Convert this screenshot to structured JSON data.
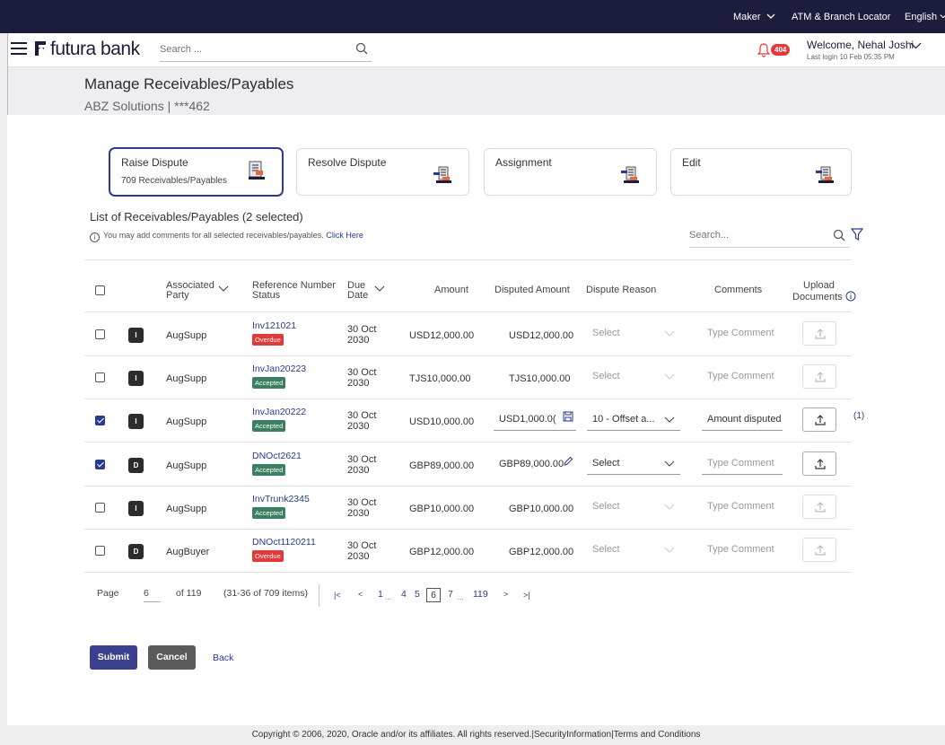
{
  "topbar": {
    "role": "Maker",
    "atm_locator": "ATM & Branch Locator",
    "language": "English"
  },
  "header": {
    "brand": "futura bank",
    "search_placeholder": "Search ...",
    "notification_count": "404",
    "welcome": "Welcome, Nehal Joshi",
    "last_login": "Last login 10 Feb 05:35 PM"
  },
  "page": {
    "title": "Manage Receivables/Payables",
    "subtitle": "ABZ Solutions | ***462"
  },
  "cards": [
    {
      "title": "Raise Dispute",
      "subtitle": "709 Receivables/Payables",
      "active": true
    },
    {
      "title": "Resolve Dispute",
      "subtitle": "",
      "active": false
    },
    {
      "title": "Assignment",
      "subtitle": "",
      "active": false
    },
    {
      "title": "Edit",
      "subtitle": "",
      "active": false
    }
  ],
  "list": {
    "title": "List of Receivables/Payables (2 selected)",
    "hint": "You may add comments for all selected receivables/payables.",
    "hint_link": "Click Here",
    "search_placeholder": "Search..."
  },
  "table": {
    "headers": {
      "associated_party": [
        "Associated",
        "Party"
      ],
      "reference": [
        "Reference Number",
        "Status"
      ],
      "due": [
        "Due",
        "Date"
      ],
      "amount": "Amount",
      "disputed_amount": "Disputed Amount",
      "dispute_reason": "Dispute Reason",
      "comments": "Comments",
      "upload": [
        "Upload",
        "Documents"
      ]
    },
    "rows": [
      {
        "checked": false,
        "avatar": "I",
        "party": "AugSupp",
        "ref": "Inv121021",
        "status": "Overdue",
        "due1": "30 Oct",
        "due2": "2030",
        "amount": "USD12,000.00",
        "disputed": "USD12,000.00",
        "reason": "Select",
        "comment": "Type Comment",
        "doc_count": ""
      },
      {
        "checked": false,
        "avatar": "I",
        "party": "AugSupp",
        "ref": "InvJan20223",
        "status": "Accepted",
        "due1": "30 Oct",
        "due2": "2030",
        "amount": "TJS10,000.00",
        "disputed": "TJS10,000.00",
        "reason": "Select",
        "comment": "Type Comment",
        "doc_count": ""
      },
      {
        "checked": true,
        "avatar": "I",
        "party": "AugSupp",
        "ref": "InvJan20222",
        "status": "Accepted",
        "due1": "30 Oct",
        "due2": "2030",
        "amount": "USD10,000.00",
        "disputed": "USD1,000.0(",
        "reason": "10 - Offset a...",
        "comment": "Amount disputed",
        "doc_count": "(1)"
      },
      {
        "checked": true,
        "avatar": "D",
        "party": "AugSupp",
        "ref": "DNOct2621",
        "status": "Accepted",
        "due1": "30 Oct",
        "due2": "2030",
        "amount": "GBP89,000.00",
        "disputed": "GBP89,000.00",
        "reason": "Select",
        "comment": "Type Comment",
        "doc_count": ""
      },
      {
        "checked": false,
        "avatar": "I",
        "party": "AugSupp",
        "ref": "InvTrunk2345",
        "status": "Accepted",
        "due1": "30 Oct",
        "due2": "2030",
        "amount": "GBP10,000.00",
        "disputed": "GBP10,000.00",
        "reason": "Select",
        "comment": "Type Comment",
        "doc_count": ""
      },
      {
        "checked": false,
        "avatar": "D",
        "party": "AugBuyer",
        "ref": "DNOct1120211",
        "status": "Overdue",
        "due1": "30 Oct",
        "due2": "2030",
        "amount": "GBP12,000.00",
        "disputed": "GBP12,000.00",
        "reason": "Select",
        "comment": "Type Comment",
        "doc_count": ""
      }
    ]
  },
  "pagination": {
    "page_label": "Page",
    "page_value": "6",
    "of_label": "of 119",
    "range": "(31-36 of 709 items)",
    "first": "|<",
    "prev": "<",
    "pages": [
      "1",
      "...",
      "4",
      "5",
      "6",
      "7",
      "...",
      "119"
    ],
    "current": "6",
    "next": ">",
    "last": ">|"
  },
  "actions": {
    "submit": "Submit",
    "cancel": "Cancel",
    "back": "Back"
  },
  "footer": {
    "copyright": "Copyright © 2006, 2020, Oracle and/or its affiliates. All rights reserved.|SecurityInformation|Terms and Conditions"
  },
  "colors": {
    "navy": "#1c1c3c",
    "accent": "#2a3a8c",
    "overdue": "#e23a3a",
    "accepted": "#3a7f5f"
  }
}
